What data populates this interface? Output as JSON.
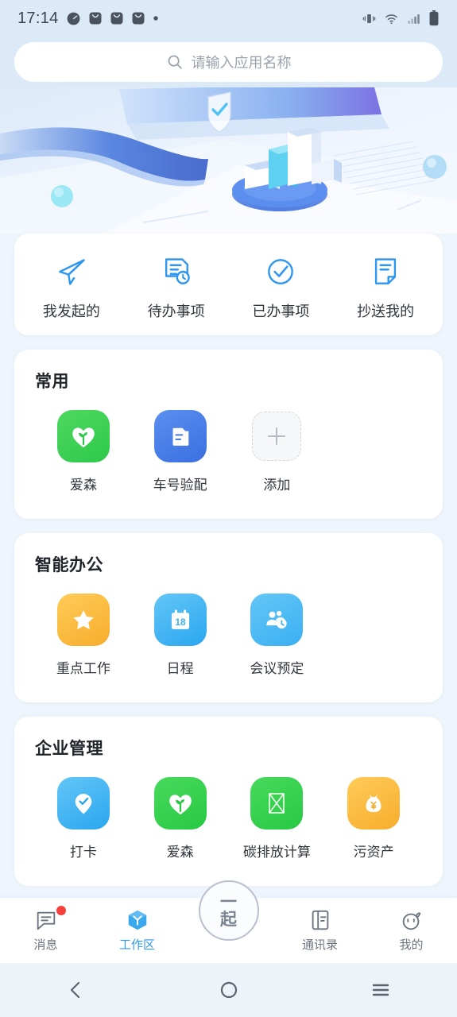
{
  "statusbar": {
    "time": "17:14",
    "left_icons": [
      "gauge-icon",
      "mail-badge-icon",
      "mail-badge-icon",
      "mail-badge-icon",
      "dot-icon"
    ],
    "right_icons": [
      "vibrate-icon",
      "wifi-icon",
      "signal-icon",
      "battery-icon"
    ]
  },
  "search": {
    "placeholder": "请输入应用名称",
    "icon": "search-icon"
  },
  "hero": {
    "alt": "3d-office-illustration-banner"
  },
  "quick_actions": [
    {
      "label": "我发起的",
      "icon": "paper-plane-icon"
    },
    {
      "label": "待办事项",
      "icon": "document-clock-icon"
    },
    {
      "label": "已办事项",
      "icon": "check-circle-icon"
    },
    {
      "label": "抄送我的",
      "icon": "document-copy-icon"
    }
  ],
  "sections": [
    {
      "title": "常用",
      "apps": [
        {
          "label": "爱森",
          "icon": "heart-sprout-icon",
          "color": "#2ec94a"
        },
        {
          "label": "车号验配",
          "icon": "folder-document-icon",
          "color": "#3a6fe0"
        },
        {
          "label": "添加",
          "icon": "plus-icon",
          "color": "#d3d7dd"
        }
      ]
    },
    {
      "title": "智能办公",
      "apps": [
        {
          "label": "重点工作",
          "icon": "star-icon",
          "color": "#f7ad2c"
        },
        {
          "label": "日程",
          "icon": "calendar-icon",
          "color": "#3bb0f2",
          "day": "18"
        },
        {
          "label": "会议预定",
          "icon": "people-clock-icon",
          "color": "#3bb0f2"
        }
      ]
    },
    {
      "title": "企业管理",
      "apps": [
        {
          "label": "打卡",
          "icon": "location-check-icon",
          "color": "#2aa6ef"
        },
        {
          "label": "爱森",
          "icon": "heart-sprout-icon",
          "color": "#27c943"
        },
        {
          "label": "碳排放计算",
          "icon": "broken-image-icon",
          "color": "#27c943"
        },
        {
          "label": "污资产",
          "icon": "money-bag-icon",
          "color": "#f7ad2c"
        }
      ]
    }
  ],
  "fab": {
    "line1": "一",
    "line2": "起"
  },
  "tabbar": {
    "active_color": "#2f9ae8",
    "items": [
      {
        "label": "消息",
        "icon": "chat-icon",
        "active": false,
        "badge": true
      },
      {
        "label": "工作区",
        "icon": "workspace-hexagon-icon",
        "active": true,
        "badge": false
      },
      {
        "label": "通讯录",
        "icon": "contacts-book-icon",
        "active": false,
        "badge": false
      },
      {
        "label": "我的",
        "icon": "profile-face-icon",
        "active": false,
        "badge": false
      }
    ]
  },
  "android_nav": [
    {
      "icon": "back-icon"
    },
    {
      "icon": "home-icon"
    },
    {
      "icon": "recents-icon"
    }
  ]
}
